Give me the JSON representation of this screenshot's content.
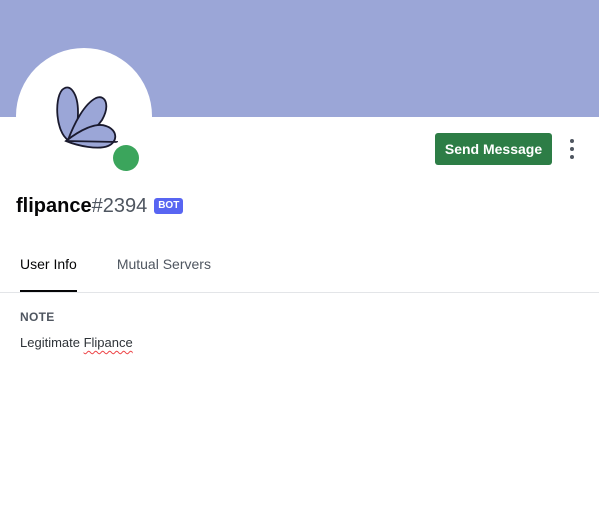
{
  "profile": {
    "username": "flipance",
    "discriminator": "#2394",
    "badge": "BOT",
    "status": "online"
  },
  "actions": {
    "send_message_label": "Send Message"
  },
  "tabs": [
    {
      "label": "User Info",
      "active": true
    },
    {
      "label": "Mutual Servers",
      "active": false
    }
  ],
  "note": {
    "heading": "NOTE",
    "text_prefix": "Legitimate ",
    "text_misspelled": "Flipance"
  },
  "colors": {
    "banner": "#9ba6d7",
    "status_online": "#3ba55c",
    "send_button": "#2d7d46",
    "bot_badge": "#5865f2"
  }
}
